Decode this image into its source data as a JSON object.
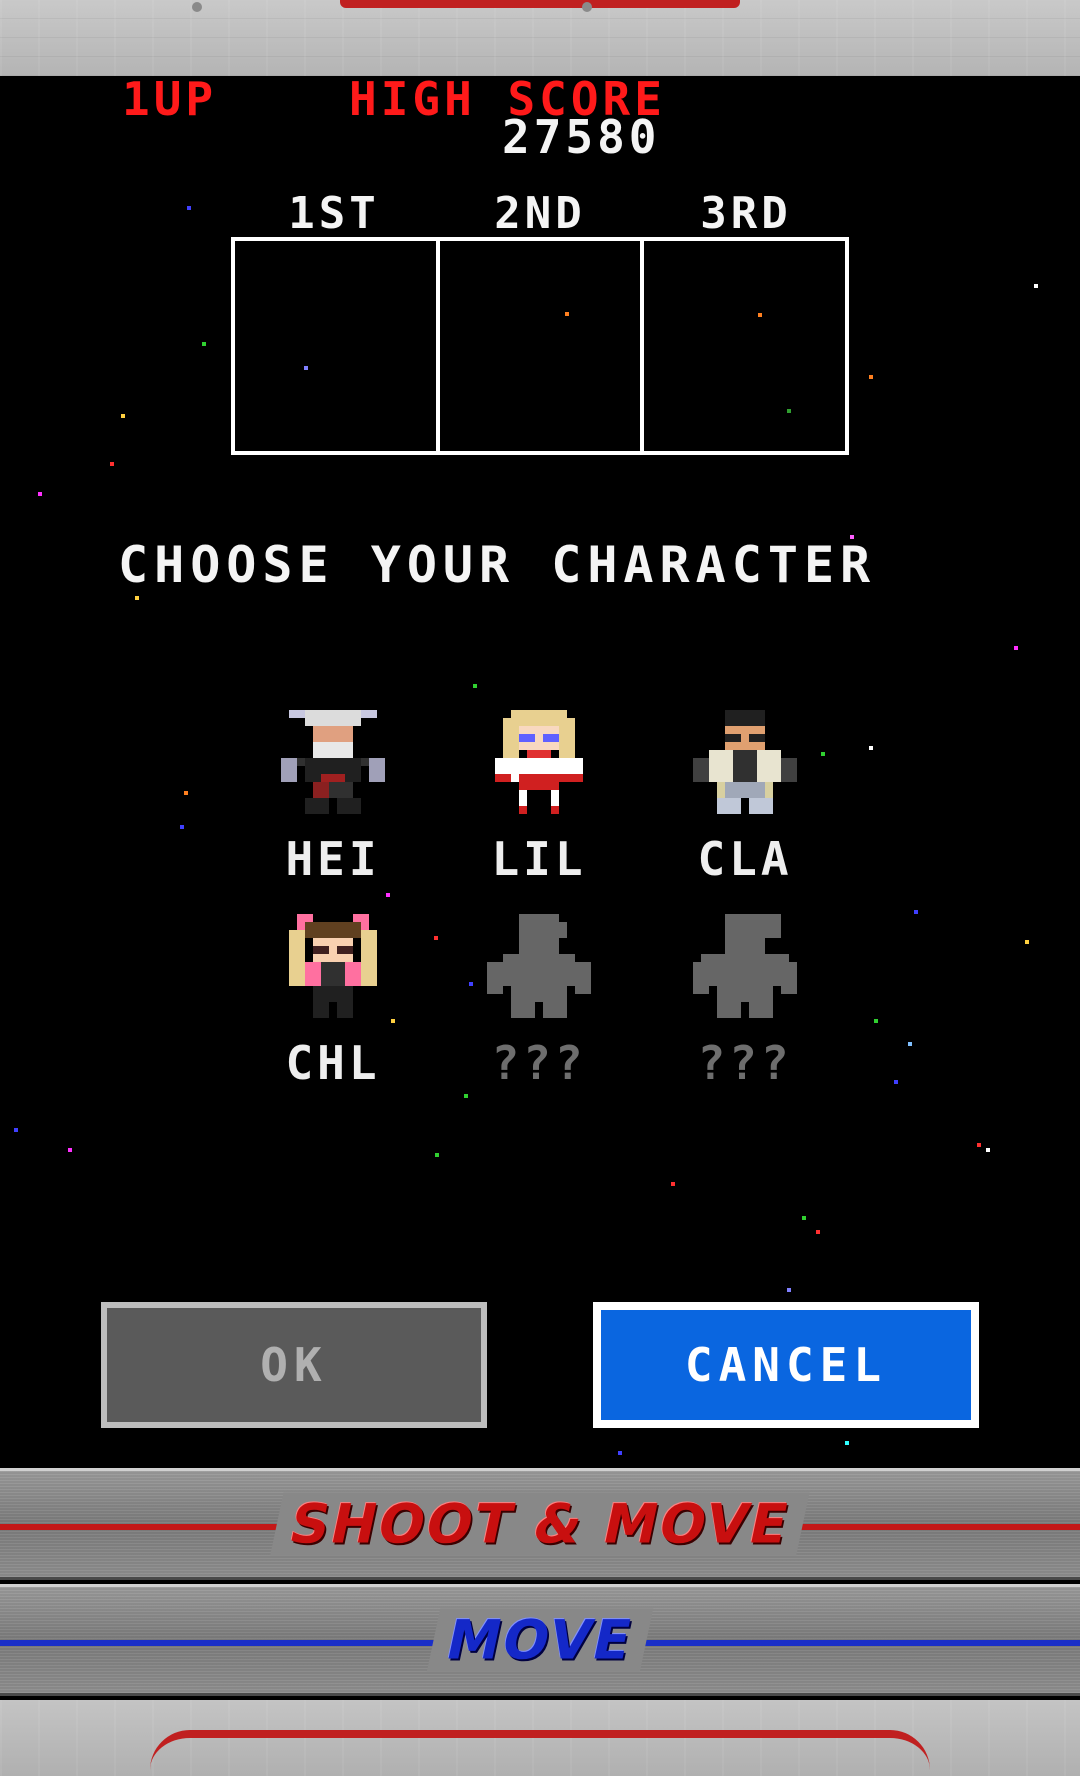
{
  "hud": {
    "player_label": "1UP",
    "high_score_label": "HIGH SCORE",
    "high_score_value": "27580"
  },
  "podium": {
    "places": [
      "1ST",
      "2ND",
      "3RD"
    ]
  },
  "select_title": "CHOOSE YOUR CHARACTER",
  "characters": [
    {
      "name": "HEI",
      "locked": false
    },
    {
      "name": "LIL",
      "locked": false
    },
    {
      "name": "CLA",
      "locked": false
    },
    {
      "name": "CHL",
      "locked": false
    },
    {
      "name": "???",
      "locked": true
    },
    {
      "name": "???",
      "locked": true
    }
  ],
  "buttons": {
    "ok_label": "OK",
    "cancel_label": "CANCEL"
  },
  "controls": {
    "shoot_move_label": "SHOOT & MOVE",
    "move_label": "MOVE"
  },
  "colors": {
    "hud_red": "#ff1a1a",
    "cancel_blue": "#0a66e0",
    "ok_gray": "#5a5a5a",
    "shoot_red": "#c41818",
    "move_blue": "#1a2fc8"
  }
}
